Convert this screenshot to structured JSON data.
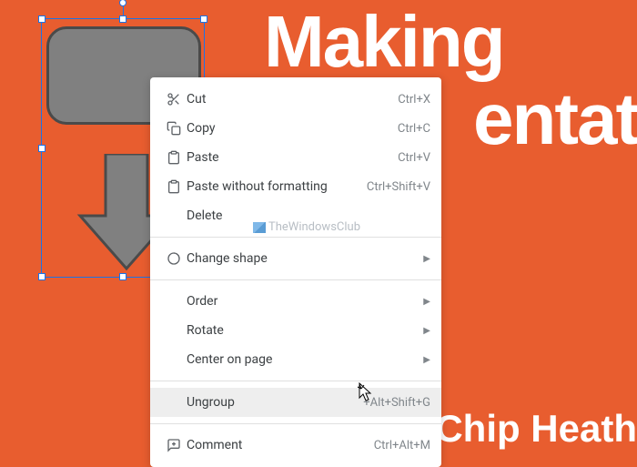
{
  "canvas": {
    "title": "Making",
    "subtitle": "entati",
    "author": "Chip Heath"
  },
  "menu": {
    "cut": {
      "label": "Cut",
      "shortcut": "Ctrl+X"
    },
    "copy": {
      "label": "Copy",
      "shortcut": "Ctrl+C"
    },
    "paste": {
      "label": "Paste",
      "shortcut": "Ctrl+V"
    },
    "paste_nofmt": {
      "label": "Paste without formatting",
      "shortcut": "Ctrl+Shift+V"
    },
    "delete": {
      "label": "Delete"
    },
    "change_shape": {
      "label": "Change shape"
    },
    "order": {
      "label": "Order"
    },
    "rotate": {
      "label": "Rotate"
    },
    "center": {
      "label": "Center on page"
    },
    "ungroup": {
      "label": "Ungroup",
      "shortcut": "+Alt+Shift+G"
    },
    "comment": {
      "label": "Comment",
      "shortcut": "Ctrl+Alt+M"
    }
  },
  "watermark": "TheWindowsClub"
}
